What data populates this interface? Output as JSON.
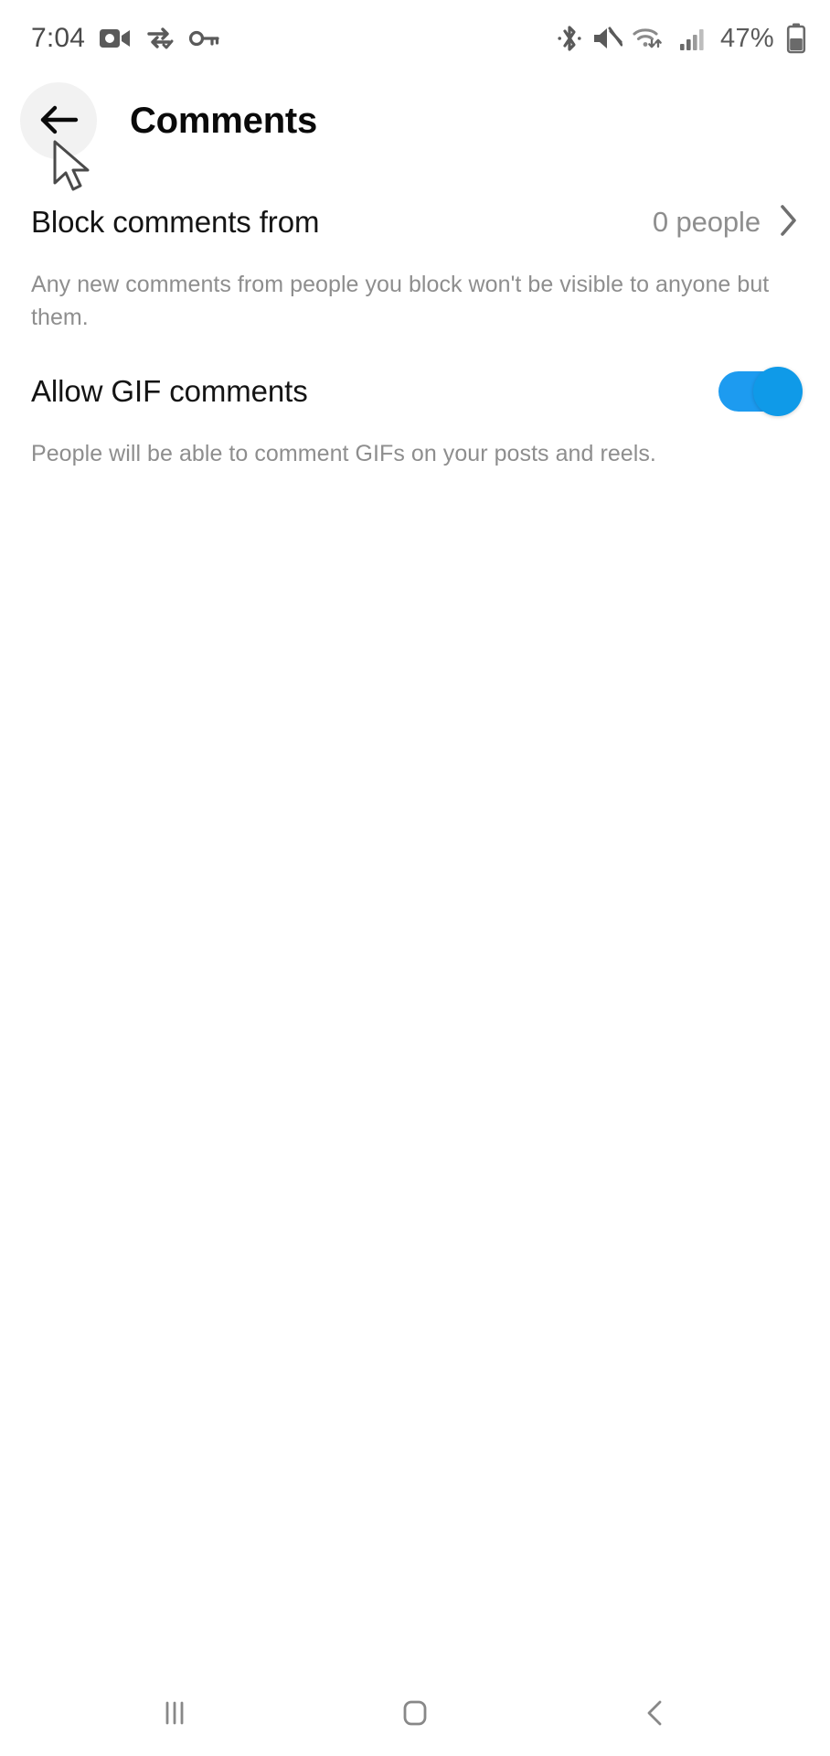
{
  "status_bar": {
    "time": "7:04",
    "battery_percent": "47%",
    "left_icons": [
      {
        "name": "camera-recording-icon",
        "label": "Camera recording"
      },
      {
        "name": "data-transfer-icon",
        "label": "Data transfer"
      },
      {
        "name": "vpn-key-icon",
        "label": "VPN key"
      }
    ],
    "right_icons": [
      {
        "name": "bluetooth-icon",
        "label": "Bluetooth"
      },
      {
        "name": "volume-muted-icon",
        "label": "Sound off"
      },
      {
        "name": "wifi-icon",
        "label": "Wi-Fi"
      },
      {
        "name": "cellular-signal-icon",
        "label": "Mobile signal"
      },
      {
        "name": "battery-icon",
        "label": "Battery"
      }
    ]
  },
  "header": {
    "title": "Comments",
    "back_icon": "arrow-left-icon"
  },
  "settings": [
    {
      "id": "block-comments-from",
      "label": "Block comments from",
      "value": "0 people",
      "chevron": "chevron-right-icon",
      "description": "Any new comments from people you block won't be visible to anyone but them.",
      "control": "navigation"
    },
    {
      "id": "allow-gif-comments",
      "label": "Allow GIF comments",
      "value": "on",
      "description": "People will be able to comment GIFs on your posts and reels.",
      "control": "toggle"
    }
  ],
  "nav_bar": {
    "recents_label": "Recent apps",
    "home_label": "Home",
    "back_label": "Back"
  },
  "colors": {
    "toggle_on": "#1d9bf0",
    "toggle_knob": "#0f9ae8",
    "primary_text": "#141414",
    "secondary_text": "#8e8e8e",
    "background": "#ffffff",
    "back_button_bg": "#f2f2f2"
  }
}
